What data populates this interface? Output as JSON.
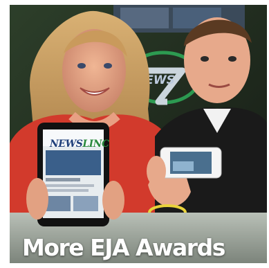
{
  "caption": "More EJA Awards",
  "tablet_screen": {
    "brand_main": "NEWS",
    "brand_accent": "LINC"
  },
  "background_logo_text": "NEWSLINC 7",
  "colors": {
    "shirt_red": "#d23a2c",
    "shirt_black": "#1a1a1a",
    "backdrop_green": "#1f3d23",
    "caption_text": "#ffffff"
  }
}
